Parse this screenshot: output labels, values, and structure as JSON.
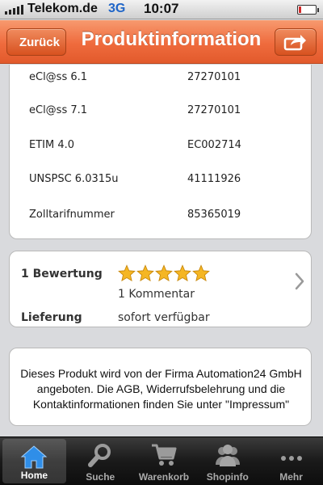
{
  "status_bar": {
    "carrier": "Telekom.de",
    "network": "3G",
    "time": "10:07"
  },
  "nav": {
    "back_label": "Zurück",
    "title": "Produktinformation"
  },
  "specs": [
    {
      "key": "eCl@ss 6.1",
      "value": "27270101"
    },
    {
      "key": "eCl@ss 7.1",
      "value": "27270101"
    },
    {
      "key": "ETIM 4.0",
      "value": "EC002714"
    },
    {
      "key": "UNSPSC 6.0315u",
      "value": "41111926"
    },
    {
      "key": "Zolltarifnummer",
      "value": "85365019"
    }
  ],
  "rating": {
    "label": "1 Bewertung",
    "stars": 5,
    "max_stars": 5,
    "comments": "1 Kommentar",
    "delivery_label": "Lieferung",
    "delivery_value": "sofort verfügbar"
  },
  "info": {
    "text": "Dieses Produkt wird von der Firma Automation24 GmbH angeboten. Die AGB, Widerrufsbelehrung und die Kontaktinformationen finden Sie unter \"Impressum\""
  },
  "tabs": [
    {
      "label": "Home",
      "icon": "home-icon",
      "active": true
    },
    {
      "label": "Suche",
      "icon": "search-icon",
      "active": false
    },
    {
      "label": "Warenkorb",
      "icon": "cart-icon",
      "active": false
    },
    {
      "label": "Shopinfo",
      "icon": "people-icon",
      "active": false
    },
    {
      "label": "Mehr",
      "icon": "more-icon",
      "active": false
    }
  ],
  "colors": {
    "nav_accent": "#ef6b3d",
    "network_blue": "#1f65c8",
    "star_gold": "#f5b623",
    "home_tab_blue": "#2f8ee8"
  }
}
